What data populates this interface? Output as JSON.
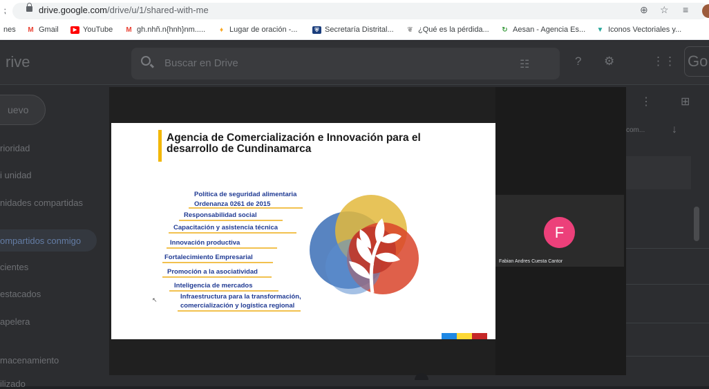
{
  "browser": {
    "url_host": "drive.google.com",
    "url_path": "/drive/u/1/shared-with-me",
    "bookmarks": [
      {
        "label": "nes",
        "icon": "apps-fragment-icon"
      },
      {
        "label": "Gmail",
        "icon": "gmail-icon",
        "color": "#ea4335"
      },
      {
        "label": "YouTube",
        "icon": "youtube-icon",
        "color": "#ff0000"
      },
      {
        "label": "gh.nhñ.n{hnh}nm.....",
        "icon": "gmail-icon",
        "color": "#ea4335"
      },
      {
        "label": "Lugar de oración -...",
        "icon": "flame-icon",
        "color": "#f9a825"
      },
      {
        "label": "Secretaría Distrital...",
        "icon": "shield-icon",
        "color": "#1a3d7c"
      },
      {
        "label": "¿Qué es la pérdida...",
        "icon": "emblem-icon",
        "color": "#9e9e9e"
      },
      {
        "label": "Aesan - Agencia Es...",
        "icon": "circle-arrow-icon",
        "color": "#43a047"
      },
      {
        "label": "Iconos Vectoriales y...",
        "icon": "v-logo-icon",
        "color": "#26a69a"
      }
    ]
  },
  "drive": {
    "logo_text": "rive",
    "search_placeholder": "Buscar en Drive",
    "new_label": "uevo",
    "nav": [
      {
        "label": "rioridad"
      },
      {
        "label": "i unidad"
      },
      {
        "label": "nidades compartidas"
      },
      {
        "label": "ompartidos conmigo",
        "active": true
      },
      {
        "label": "cientes"
      },
      {
        "label": "estacados"
      },
      {
        "label": "apelera"
      },
      {
        "label": "macenamiento"
      },
      {
        "label": "ilizado"
      }
    ],
    "right_col_text": "com...",
    "go_text": "Go"
  },
  "meeting": {
    "slide": {
      "title": "Agencia de Comercialización e Innovación para el desarrollo de Cundinamarca",
      "items": [
        "Política de seguridad alimentaria",
        "Ordenanza 0261 de 2015",
        "Responsabilidad social",
        "Capacitación y asistencia técnica",
        "Innovación productiva",
        "Fortalecimiento Empresarial",
        "Promoción a la asociatividad",
        "Inteligencia de mercados",
        "Infraestructura para la transformación,",
        "comercialización y logística regional"
      ],
      "flag_colors": [
        "#1e88e5",
        "#fdd835",
        "#c62828"
      ]
    },
    "participant": {
      "initial": "F",
      "name": "Fabian Andres Cuesta Cantor",
      "avatar_color": "#ec407a"
    }
  }
}
